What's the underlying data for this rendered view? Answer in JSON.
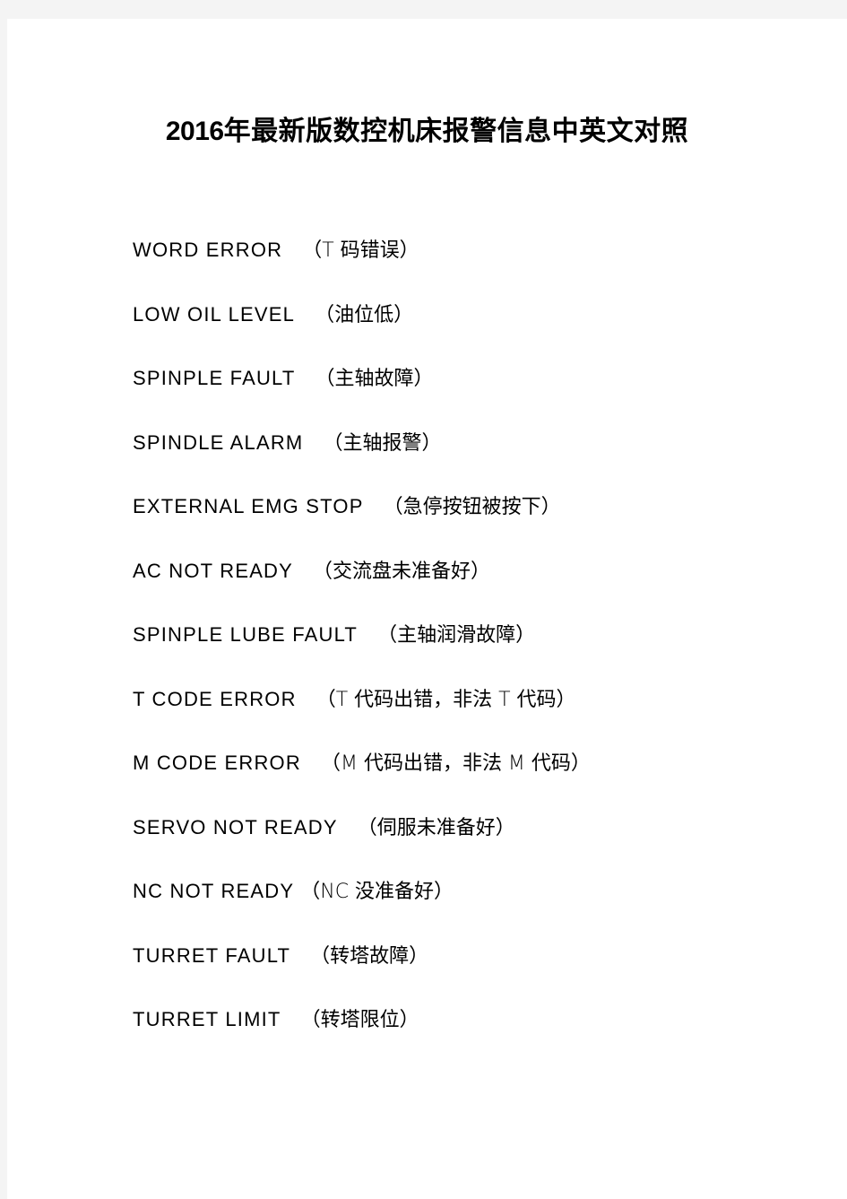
{
  "page": {
    "background_color": "#f4f4f4",
    "sheet_color": "#ffffff",
    "text_color": "#000000"
  },
  "title": {
    "number": "2016",
    "cjk": "年最新版数控机床报警信息中英文对照",
    "full": "2016年最新版数控机床报警信息中英文对照"
  },
  "entries": [
    {
      "code": "WORD ERROR",
      "gloss": "（T 码错误）",
      "gap": "wide"
    },
    {
      "code": "LOW OIL LEVEL",
      "gloss": "（油位低）",
      "gap": "wide"
    },
    {
      "code": "SPINPLE FAULT",
      "gloss": "（主轴故障）",
      "gap": "wide"
    },
    {
      "code": "SPINDLE ALARM",
      "gloss": "（主轴报警）",
      "gap": "wide"
    },
    {
      "code": "EXTERNAL EMG STOP",
      "gloss": "（急停按钮被按下）",
      "gap": "wide"
    },
    {
      "code": "AC NOT READY",
      "gloss": "（交流盘未准备好）",
      "gap": "wide"
    },
    {
      "code": "SPINPLE LUBE FAULT",
      "gloss": "（主轴润滑故障）",
      "gap": "wide"
    },
    {
      "code": "T CODE ERROR",
      "gloss": "（T 代码出错，非法 T 代码）",
      "gap": "wide"
    },
    {
      "code": "M CODE ERROR",
      "gloss": "（M 代码出错，非法 M 代码）",
      "gap": "wide"
    },
    {
      "code": "SERVO NOT READY",
      "gloss": "（伺服未准备好）",
      "gap": "wide"
    },
    {
      "code": "NC NOT READY",
      "gloss": "（NC 没准备好）",
      "gap": "narrow"
    },
    {
      "code": "TURRET FAULT",
      "gloss": "（转塔故障）",
      "gap": "wide"
    },
    {
      "code": "TURRET LIMIT",
      "gloss": "（转塔限位）",
      "gap": "wide"
    }
  ]
}
